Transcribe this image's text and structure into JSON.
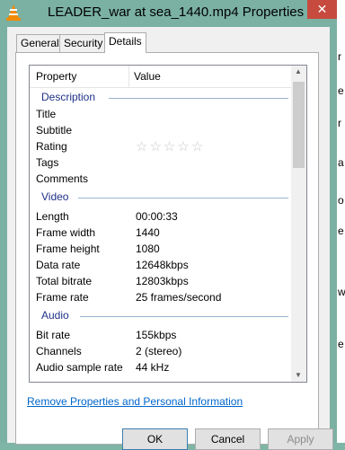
{
  "window": {
    "title": "LEADER_war at sea_1440.mp4 Properties",
    "close_glyph": "✕"
  },
  "tabs": [
    {
      "label": "General"
    },
    {
      "label": "Security"
    },
    {
      "label": "Details"
    }
  ],
  "active_tab": "Details",
  "columns": {
    "property": "Property",
    "value": "Value"
  },
  "sections": {
    "description": {
      "label": "Description",
      "rows": [
        {
          "property": "Title",
          "value": ""
        },
        {
          "property": "Subtitle",
          "value": ""
        },
        {
          "property": "Rating",
          "value": ""
        },
        {
          "property": "Tags",
          "value": ""
        },
        {
          "property": "Comments",
          "value": ""
        }
      ],
      "rating_stars": 0
    },
    "video": {
      "label": "Video",
      "rows": [
        {
          "property": "Length",
          "value": "00:00:33"
        },
        {
          "property": "Frame width",
          "value": "1440"
        },
        {
          "property": "Frame height",
          "value": "1080"
        },
        {
          "property": "Data rate",
          "value": "12648kbps"
        },
        {
          "property": "Total bitrate",
          "value": "12803kbps"
        },
        {
          "property": "Frame rate",
          "value": "25 frames/second"
        }
      ]
    },
    "audio": {
      "label": "Audio",
      "rows": [
        {
          "property": "Bit rate",
          "value": "155kbps"
        },
        {
          "property": "Channels",
          "value": "2 (stereo)"
        },
        {
          "property": "Audio sample rate",
          "value": "44 kHz"
        }
      ]
    }
  },
  "remove_link": "Remove Properties and Personal Information",
  "buttons": {
    "ok": "OK",
    "cancel": "Cancel",
    "apply": "Apply"
  },
  "background_window_letters": [
    "r",
    "e",
    "r",
    "a",
    "o",
    "e",
    "w",
    "e"
  ],
  "colors": {
    "accent_group": "#1e3287",
    "link": "#0066cc",
    "close": "#c74a3e"
  }
}
